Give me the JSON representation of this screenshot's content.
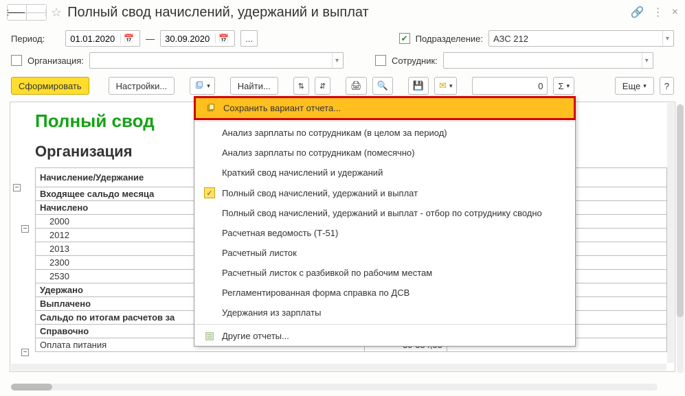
{
  "header": {
    "title": "Полный свод начислений, удержаний и выплат"
  },
  "filters": {
    "period_label": "Период:",
    "date_from": "01.01.2020",
    "date_to": "30.09.2020",
    "dash": "—",
    "division_checked": true,
    "division_label": "Подразделение:",
    "division_value": "АЗС 212",
    "org_checked": false,
    "org_label": "Организация:",
    "org_value": "",
    "employee_checked": false,
    "employee_label": "Сотрудник:",
    "employee_value": ""
  },
  "toolbar": {
    "generate": "Сформировать",
    "settings": "Настройки...",
    "find": "Найти...",
    "num_value": "0",
    "sigma": "Σ",
    "more": "Еще",
    "help": "?"
  },
  "dropdown": {
    "save_variant": "Сохранить вариант отчета...",
    "items": [
      "Анализ зарплаты по сотрудникам (в целом за период)",
      "Анализ зарплаты по сотрудникам (помесячно)",
      "Краткий свод начислений и удержаний",
      "Полный свод начислений, удержаний и выплат",
      "Полный свод начислений, удержаний и выплат - отбор по сотруднику сводно",
      "Расчетная ведомость (Т-51)",
      "Расчетный листок",
      "Расчетный листок с разбивкой по рабочим местам",
      "Регламентированная форма справка по ДСВ",
      "Удержания из зарплаты"
    ],
    "selected_index": 3,
    "other_reports": "Другие отчеты..."
  },
  "report": {
    "title": "Полный свод",
    "org_heading": "Организация",
    "col_label": "Начисление/Удержание",
    "rows": [
      {
        "label": "Входящее сальдо месяца",
        "bold": true
      },
      {
        "label": "Начислено",
        "bold": true
      },
      {
        "label": "2000",
        "indent": 1
      },
      {
        "label": "2012",
        "indent": 1
      },
      {
        "label": "2013",
        "indent": 1
      },
      {
        "label": "2300",
        "indent": 1
      },
      {
        "label": "2530",
        "indent": 1
      },
      {
        "label": "Удержано",
        "bold": true
      },
      {
        "label": "Выплачено",
        "bold": true
      },
      {
        "label": "Сальдо по итогам расчетов за",
        "bold": true
      },
      {
        "label": "Справочно",
        "bold": true
      },
      {
        "label": "Оплата питания",
        "value": "39 354,55"
      }
    ]
  }
}
